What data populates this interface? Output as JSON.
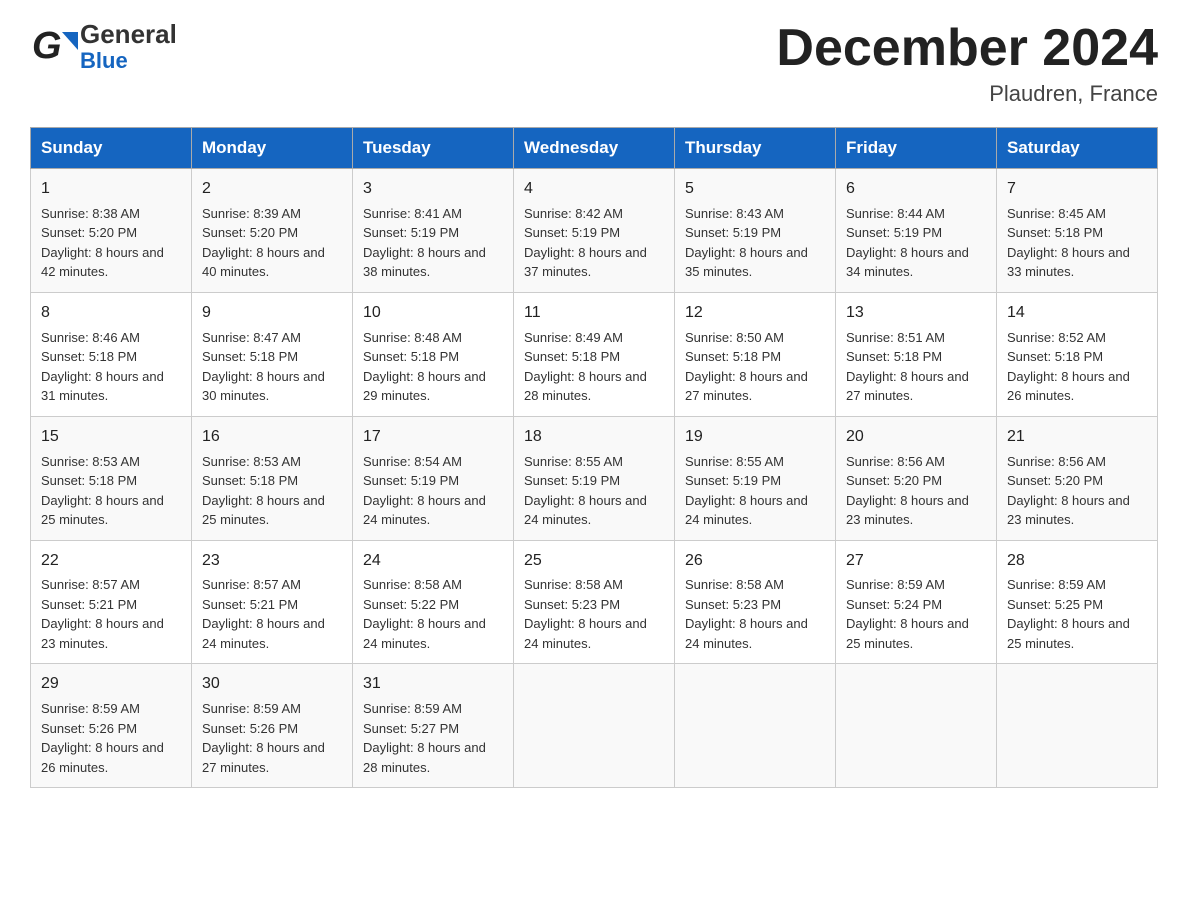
{
  "header": {
    "title": "December 2024",
    "subtitle": "Plaudren, France",
    "logo_line1": "General",
    "logo_line2": "Blue"
  },
  "days_of_week": [
    "Sunday",
    "Monday",
    "Tuesday",
    "Wednesday",
    "Thursday",
    "Friday",
    "Saturday"
  ],
  "weeks": [
    [
      {
        "day": "1",
        "sunrise": "8:38 AM",
        "sunset": "5:20 PM",
        "daylight": "8 hours and 42 minutes."
      },
      {
        "day": "2",
        "sunrise": "8:39 AM",
        "sunset": "5:20 PM",
        "daylight": "8 hours and 40 minutes."
      },
      {
        "day": "3",
        "sunrise": "8:41 AM",
        "sunset": "5:19 PM",
        "daylight": "8 hours and 38 minutes."
      },
      {
        "day": "4",
        "sunrise": "8:42 AM",
        "sunset": "5:19 PM",
        "daylight": "8 hours and 37 minutes."
      },
      {
        "day": "5",
        "sunrise": "8:43 AM",
        "sunset": "5:19 PM",
        "daylight": "8 hours and 35 minutes."
      },
      {
        "day": "6",
        "sunrise": "8:44 AM",
        "sunset": "5:19 PM",
        "daylight": "8 hours and 34 minutes."
      },
      {
        "day": "7",
        "sunrise": "8:45 AM",
        "sunset": "5:18 PM",
        "daylight": "8 hours and 33 minutes."
      }
    ],
    [
      {
        "day": "8",
        "sunrise": "8:46 AM",
        "sunset": "5:18 PM",
        "daylight": "8 hours and 31 minutes."
      },
      {
        "day": "9",
        "sunrise": "8:47 AM",
        "sunset": "5:18 PM",
        "daylight": "8 hours and 30 minutes."
      },
      {
        "day": "10",
        "sunrise": "8:48 AM",
        "sunset": "5:18 PM",
        "daylight": "8 hours and 29 minutes."
      },
      {
        "day": "11",
        "sunrise": "8:49 AM",
        "sunset": "5:18 PM",
        "daylight": "8 hours and 28 minutes."
      },
      {
        "day": "12",
        "sunrise": "8:50 AM",
        "sunset": "5:18 PM",
        "daylight": "8 hours and 27 minutes."
      },
      {
        "day": "13",
        "sunrise": "8:51 AM",
        "sunset": "5:18 PM",
        "daylight": "8 hours and 27 minutes."
      },
      {
        "day": "14",
        "sunrise": "8:52 AM",
        "sunset": "5:18 PM",
        "daylight": "8 hours and 26 minutes."
      }
    ],
    [
      {
        "day": "15",
        "sunrise": "8:53 AM",
        "sunset": "5:18 PM",
        "daylight": "8 hours and 25 minutes."
      },
      {
        "day": "16",
        "sunrise": "8:53 AM",
        "sunset": "5:18 PM",
        "daylight": "8 hours and 25 minutes."
      },
      {
        "day": "17",
        "sunrise": "8:54 AM",
        "sunset": "5:19 PM",
        "daylight": "8 hours and 24 minutes."
      },
      {
        "day": "18",
        "sunrise": "8:55 AM",
        "sunset": "5:19 PM",
        "daylight": "8 hours and 24 minutes."
      },
      {
        "day": "19",
        "sunrise": "8:55 AM",
        "sunset": "5:19 PM",
        "daylight": "8 hours and 24 minutes."
      },
      {
        "day": "20",
        "sunrise": "8:56 AM",
        "sunset": "5:20 PM",
        "daylight": "8 hours and 23 minutes."
      },
      {
        "day": "21",
        "sunrise": "8:56 AM",
        "sunset": "5:20 PM",
        "daylight": "8 hours and 23 minutes."
      }
    ],
    [
      {
        "day": "22",
        "sunrise": "8:57 AM",
        "sunset": "5:21 PM",
        "daylight": "8 hours and 23 minutes."
      },
      {
        "day": "23",
        "sunrise": "8:57 AM",
        "sunset": "5:21 PM",
        "daylight": "8 hours and 24 minutes."
      },
      {
        "day": "24",
        "sunrise": "8:58 AM",
        "sunset": "5:22 PM",
        "daylight": "8 hours and 24 minutes."
      },
      {
        "day": "25",
        "sunrise": "8:58 AM",
        "sunset": "5:23 PM",
        "daylight": "8 hours and 24 minutes."
      },
      {
        "day": "26",
        "sunrise": "8:58 AM",
        "sunset": "5:23 PM",
        "daylight": "8 hours and 24 minutes."
      },
      {
        "day": "27",
        "sunrise": "8:59 AM",
        "sunset": "5:24 PM",
        "daylight": "8 hours and 25 minutes."
      },
      {
        "day": "28",
        "sunrise": "8:59 AM",
        "sunset": "5:25 PM",
        "daylight": "8 hours and 25 minutes."
      }
    ],
    [
      {
        "day": "29",
        "sunrise": "8:59 AM",
        "sunset": "5:26 PM",
        "daylight": "8 hours and 26 minutes."
      },
      {
        "day": "30",
        "sunrise": "8:59 AM",
        "sunset": "5:26 PM",
        "daylight": "8 hours and 27 minutes."
      },
      {
        "day": "31",
        "sunrise": "8:59 AM",
        "sunset": "5:27 PM",
        "daylight": "8 hours and 28 minutes."
      },
      {
        "day": "",
        "sunrise": "",
        "sunset": "",
        "daylight": ""
      },
      {
        "day": "",
        "sunrise": "",
        "sunset": "",
        "daylight": ""
      },
      {
        "day": "",
        "sunrise": "",
        "sunset": "",
        "daylight": ""
      },
      {
        "day": "",
        "sunrise": "",
        "sunset": "",
        "daylight": ""
      }
    ]
  ],
  "labels": {
    "sunrise": "Sunrise:",
    "sunset": "Sunset:",
    "daylight": "Daylight:"
  },
  "colors": {
    "header_bg": "#1565c0",
    "header_text": "#ffffff",
    "border": "#aaaaaa"
  }
}
